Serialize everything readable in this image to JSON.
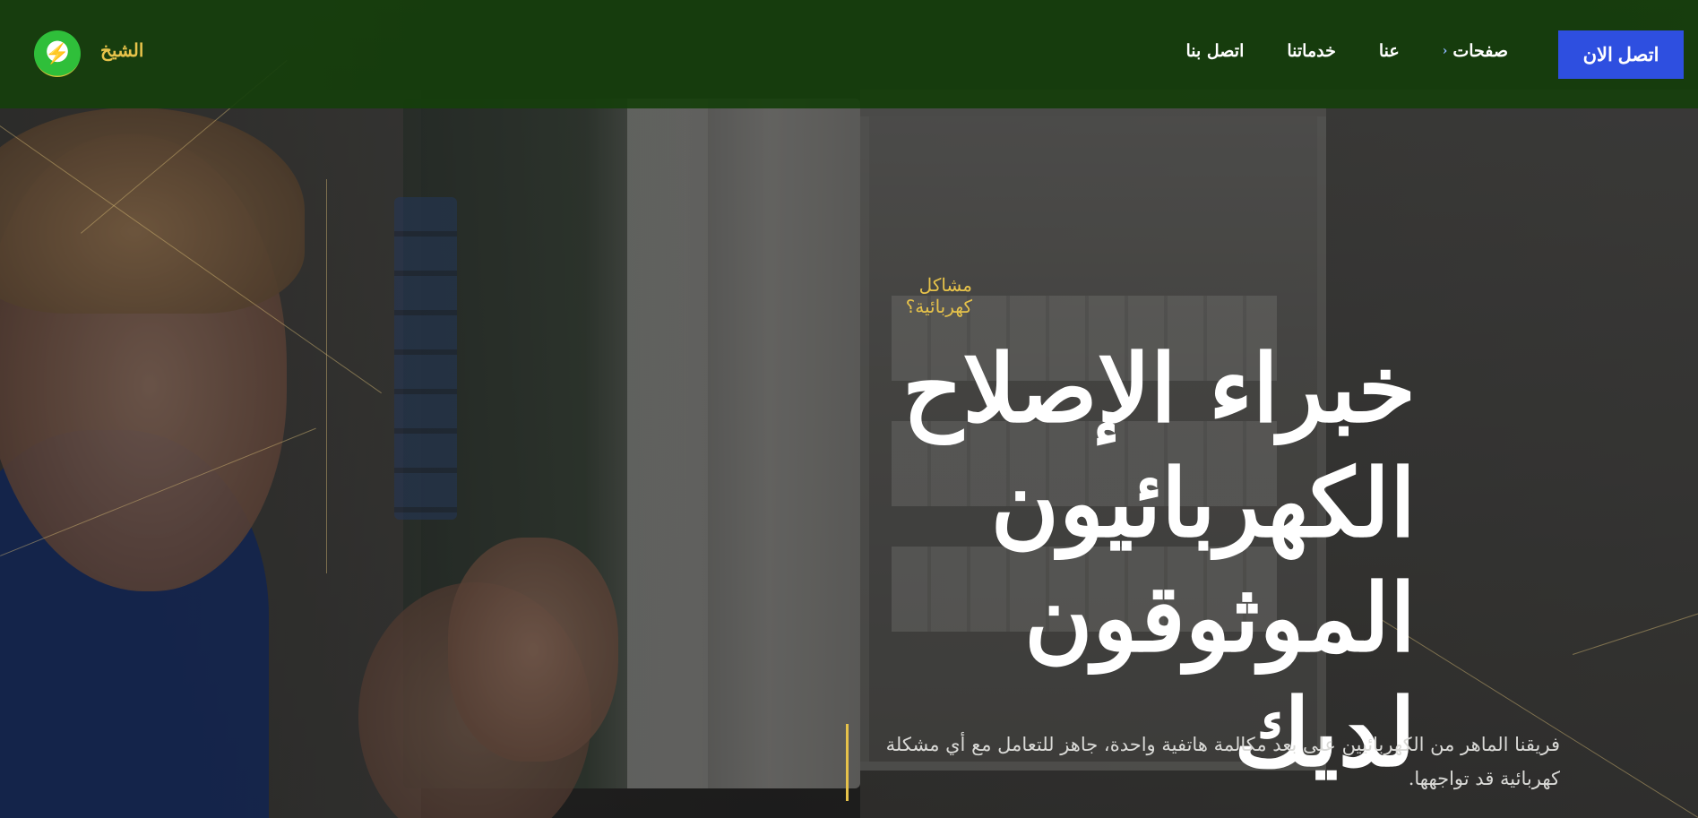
{
  "header": {
    "brand": "الشيخ",
    "logo_icon": "electrician-mascot-icon",
    "nav": [
      {
        "label": "صفحات",
        "has_dropdown": true
      },
      {
        "label": "عنا",
        "has_dropdown": false
      },
      {
        "label": "خدماتنا",
        "has_dropdown": false
      },
      {
        "label": "اتصل بنا",
        "has_dropdown": false
      }
    ],
    "cta_label": "اتصل الان"
  },
  "hero": {
    "eyebrow": "مشاكل كهربائية؟",
    "title_lines": [
      "خبراء الإصلاح",
      "الكهربائيون",
      "الموثوقون لديك"
    ],
    "description": "فريقنا الماهر من الكهربائيين على بعد مكالمة هاتفية واحدة، جاهز للتعامل مع أي مشكلة كهربائية قد تواجهها."
  },
  "colors": {
    "header_bg": "#163e0c",
    "accent_gold": "#e6c24a",
    "cta_blue": "#2e4fe0",
    "title_white": "#ffffff"
  }
}
